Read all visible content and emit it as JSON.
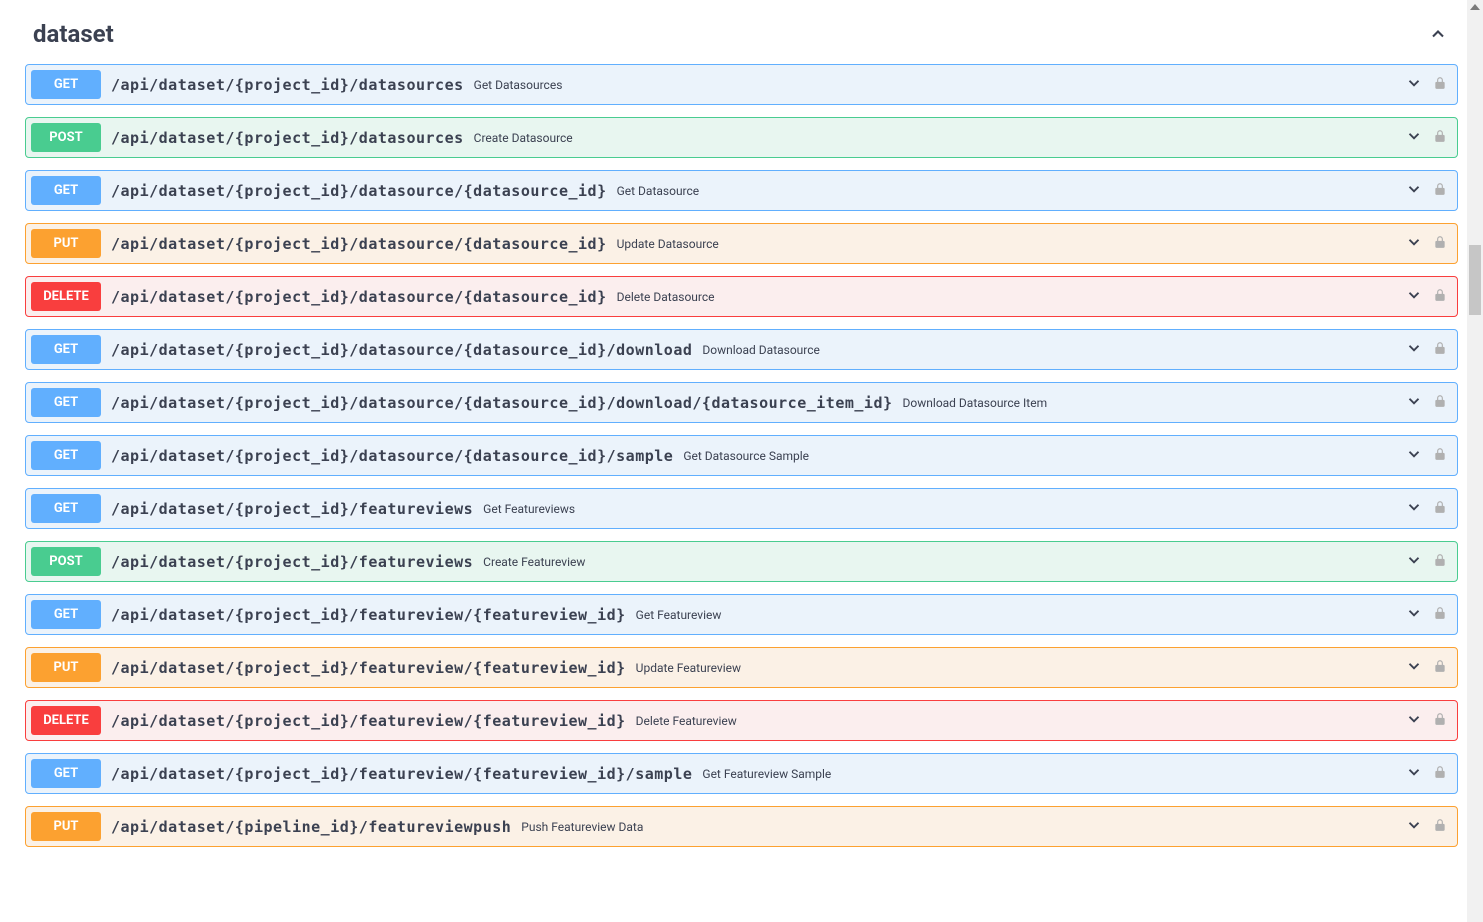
{
  "section": {
    "title": "dataset"
  },
  "methods": {
    "get": "GET",
    "post": "POST",
    "put": "PUT",
    "delete": "DELETE"
  },
  "endpoints": [
    {
      "method": "get",
      "path": "/api/dataset/{project_id}/datasources",
      "desc": "Get Datasources"
    },
    {
      "method": "post",
      "path": "/api/dataset/{project_id}/datasources",
      "desc": "Create Datasource"
    },
    {
      "method": "get",
      "path": "/api/dataset/{project_id}/datasource/{datasource_id}",
      "desc": "Get Datasource"
    },
    {
      "method": "put",
      "path": "/api/dataset/{project_id}/datasource/{datasource_id}",
      "desc": "Update Datasource"
    },
    {
      "method": "delete",
      "path": "/api/dataset/{project_id}/datasource/{datasource_id}",
      "desc": "Delete Datasource"
    },
    {
      "method": "get",
      "path": "/api/dataset/{project_id}/datasource/{datasource_id}/download",
      "desc": "Download Datasource"
    },
    {
      "method": "get",
      "path": "/api/dataset/{project_id}/datasource/{datasource_id}/download/{datasource_item_id}",
      "desc": "Download Datasource Item"
    },
    {
      "method": "get",
      "path": "/api/dataset/{project_id}/datasource/{datasource_id}/sample",
      "desc": "Get Datasource Sample"
    },
    {
      "method": "get",
      "path": "/api/dataset/{project_id}/featureviews",
      "desc": "Get Featureviews"
    },
    {
      "method": "post",
      "path": "/api/dataset/{project_id}/featureviews",
      "desc": "Create Featureview"
    },
    {
      "method": "get",
      "path": "/api/dataset/{project_id}/featureview/{featureview_id}",
      "desc": "Get Featureview"
    },
    {
      "method": "put",
      "path": "/api/dataset/{project_id}/featureview/{featureview_id}",
      "desc": "Update Featureview"
    },
    {
      "method": "delete",
      "path": "/api/dataset/{project_id}/featureview/{featureview_id}",
      "desc": "Delete Featureview"
    },
    {
      "method": "get",
      "path": "/api/dataset/{project_id}/featureview/{featureview_id}/sample",
      "desc": "Get Featureview Sample"
    },
    {
      "method": "put",
      "path": "/api/dataset/{pipeline_id}/featureviewpush",
      "desc": "Push Featureview Data"
    }
  ]
}
